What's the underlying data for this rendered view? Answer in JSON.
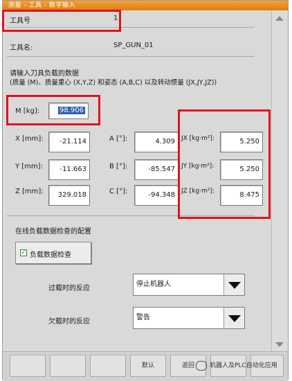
{
  "window": {
    "title": "测量 - 工具 - 数字输入"
  },
  "tool": {
    "number_label": "工具号",
    "number_value": "1",
    "name_label": "工具名:",
    "name_value": "SP_GUN_01"
  },
  "instruction": {
    "line1": "请输入刀具负载的数据",
    "line2": "(质量 (M)、质量重心 (X,Y,Z) 和姿态 (A,B,C) 以及转动惯量 (JX,JY,JZ))"
  },
  "mass": {
    "label": "M [kg]:",
    "value": "98.906"
  },
  "fields": {
    "x": {
      "label": "X [mm]:",
      "value": "-21.114"
    },
    "y": {
      "label": "Y [mm]:",
      "value": "-11.663"
    },
    "z": {
      "label": "Z [mm]:",
      "value": "329.018"
    },
    "a": {
      "label": "A [°]:",
      "value": "4.309"
    },
    "b": {
      "label": "B [°]:",
      "value": "-85.547"
    },
    "c": {
      "label": "C [°]:",
      "value": "-94.348"
    },
    "jx": {
      "label": "JX [kg·m²]:",
      "value": "5.250"
    },
    "jy": {
      "label": "JY [kg·m²]:",
      "value": "5.250"
    },
    "jz": {
      "label": "JZ [kg·m²]:",
      "value": "8.475"
    }
  },
  "online_check": {
    "section_label": "在线负载数据检查的配置",
    "checkbox_label": "负载数据检查",
    "checked": true,
    "overload_label": "过载时的反应",
    "overload_value": "停止机器人",
    "underload_label": "欠载时的反应",
    "underload_value": "警告"
  },
  "softkeys": {
    "default_label": "默认",
    "back_label": "返回"
  },
  "watermark": {
    "text": "机器人及PLC自动化应用"
  },
  "colors": {
    "title_bar": "#e88a1c",
    "highlight_box": "#e3121b",
    "selection": "#2f5fa8"
  }
}
